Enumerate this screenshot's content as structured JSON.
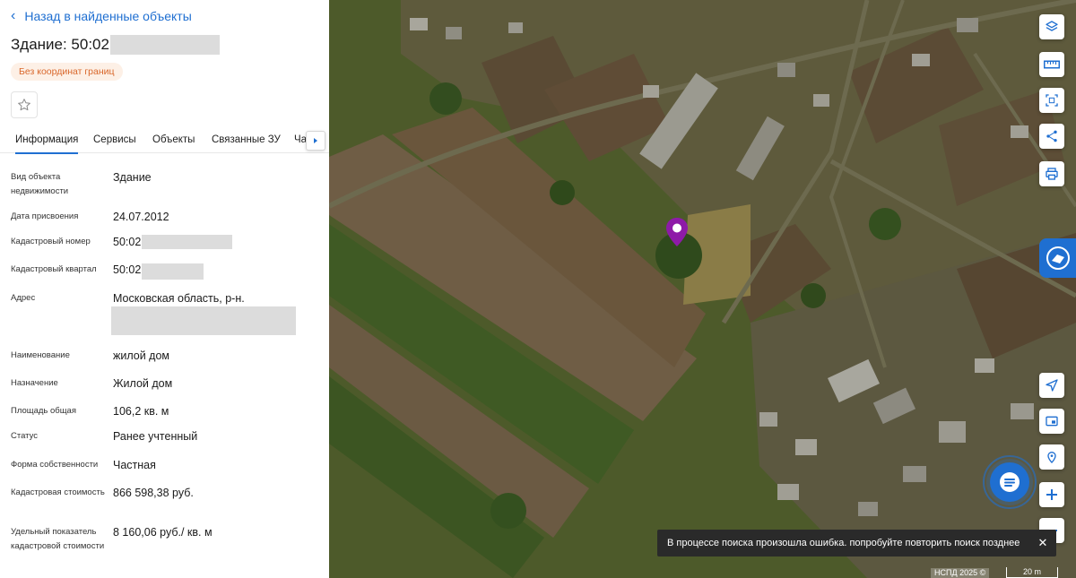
{
  "panel": {
    "back_label": "Назад в найденные объекты",
    "title_prefix": "Здание: 50:02",
    "badge": "Без координат границ",
    "tabs": [
      {
        "label": "Информация"
      },
      {
        "label": "Сервисы"
      },
      {
        "label": "Объекты"
      },
      {
        "label": "Связанные ЗУ"
      },
      {
        "label": "Ча"
      }
    ],
    "fields": [
      {
        "label": "Вид объекта недвижимости",
        "value": "Здание"
      },
      {
        "label": "Дата присвоения",
        "value": "24.07.2012"
      },
      {
        "label": "Кадастровый номер",
        "value": "50:02"
      },
      {
        "label": "Кадастровый квартал",
        "value": "50:02"
      },
      {
        "label": "Адрес",
        "value": "Московская область, р-н."
      },
      {
        "label": "Наименование",
        "value": "жилой дом"
      },
      {
        "label": "Назначение",
        "value": "Жилой дом"
      },
      {
        "label": "Площадь общая",
        "value": "106,2 кв. м"
      },
      {
        "label": "Статус",
        "value": "Ранее учтенный"
      },
      {
        "label": "Форма собственности",
        "value": "Частная"
      },
      {
        "label": "Кадастровая стоимость",
        "value": "866 598,38 руб."
      },
      {
        "label": "Удельный показатель кадастровой стоимости",
        "value": "8 160,06 руб./ кв. м"
      }
    ]
  },
  "map": {
    "toast": "В процессе поиска произошла ошибка. попробуйте повторить поиск позднее",
    "attribution": "НСПД 2025 ©",
    "scale": "20 m",
    "marker_color": "#8e1aa8",
    "accent": "#1f6fd1"
  }
}
